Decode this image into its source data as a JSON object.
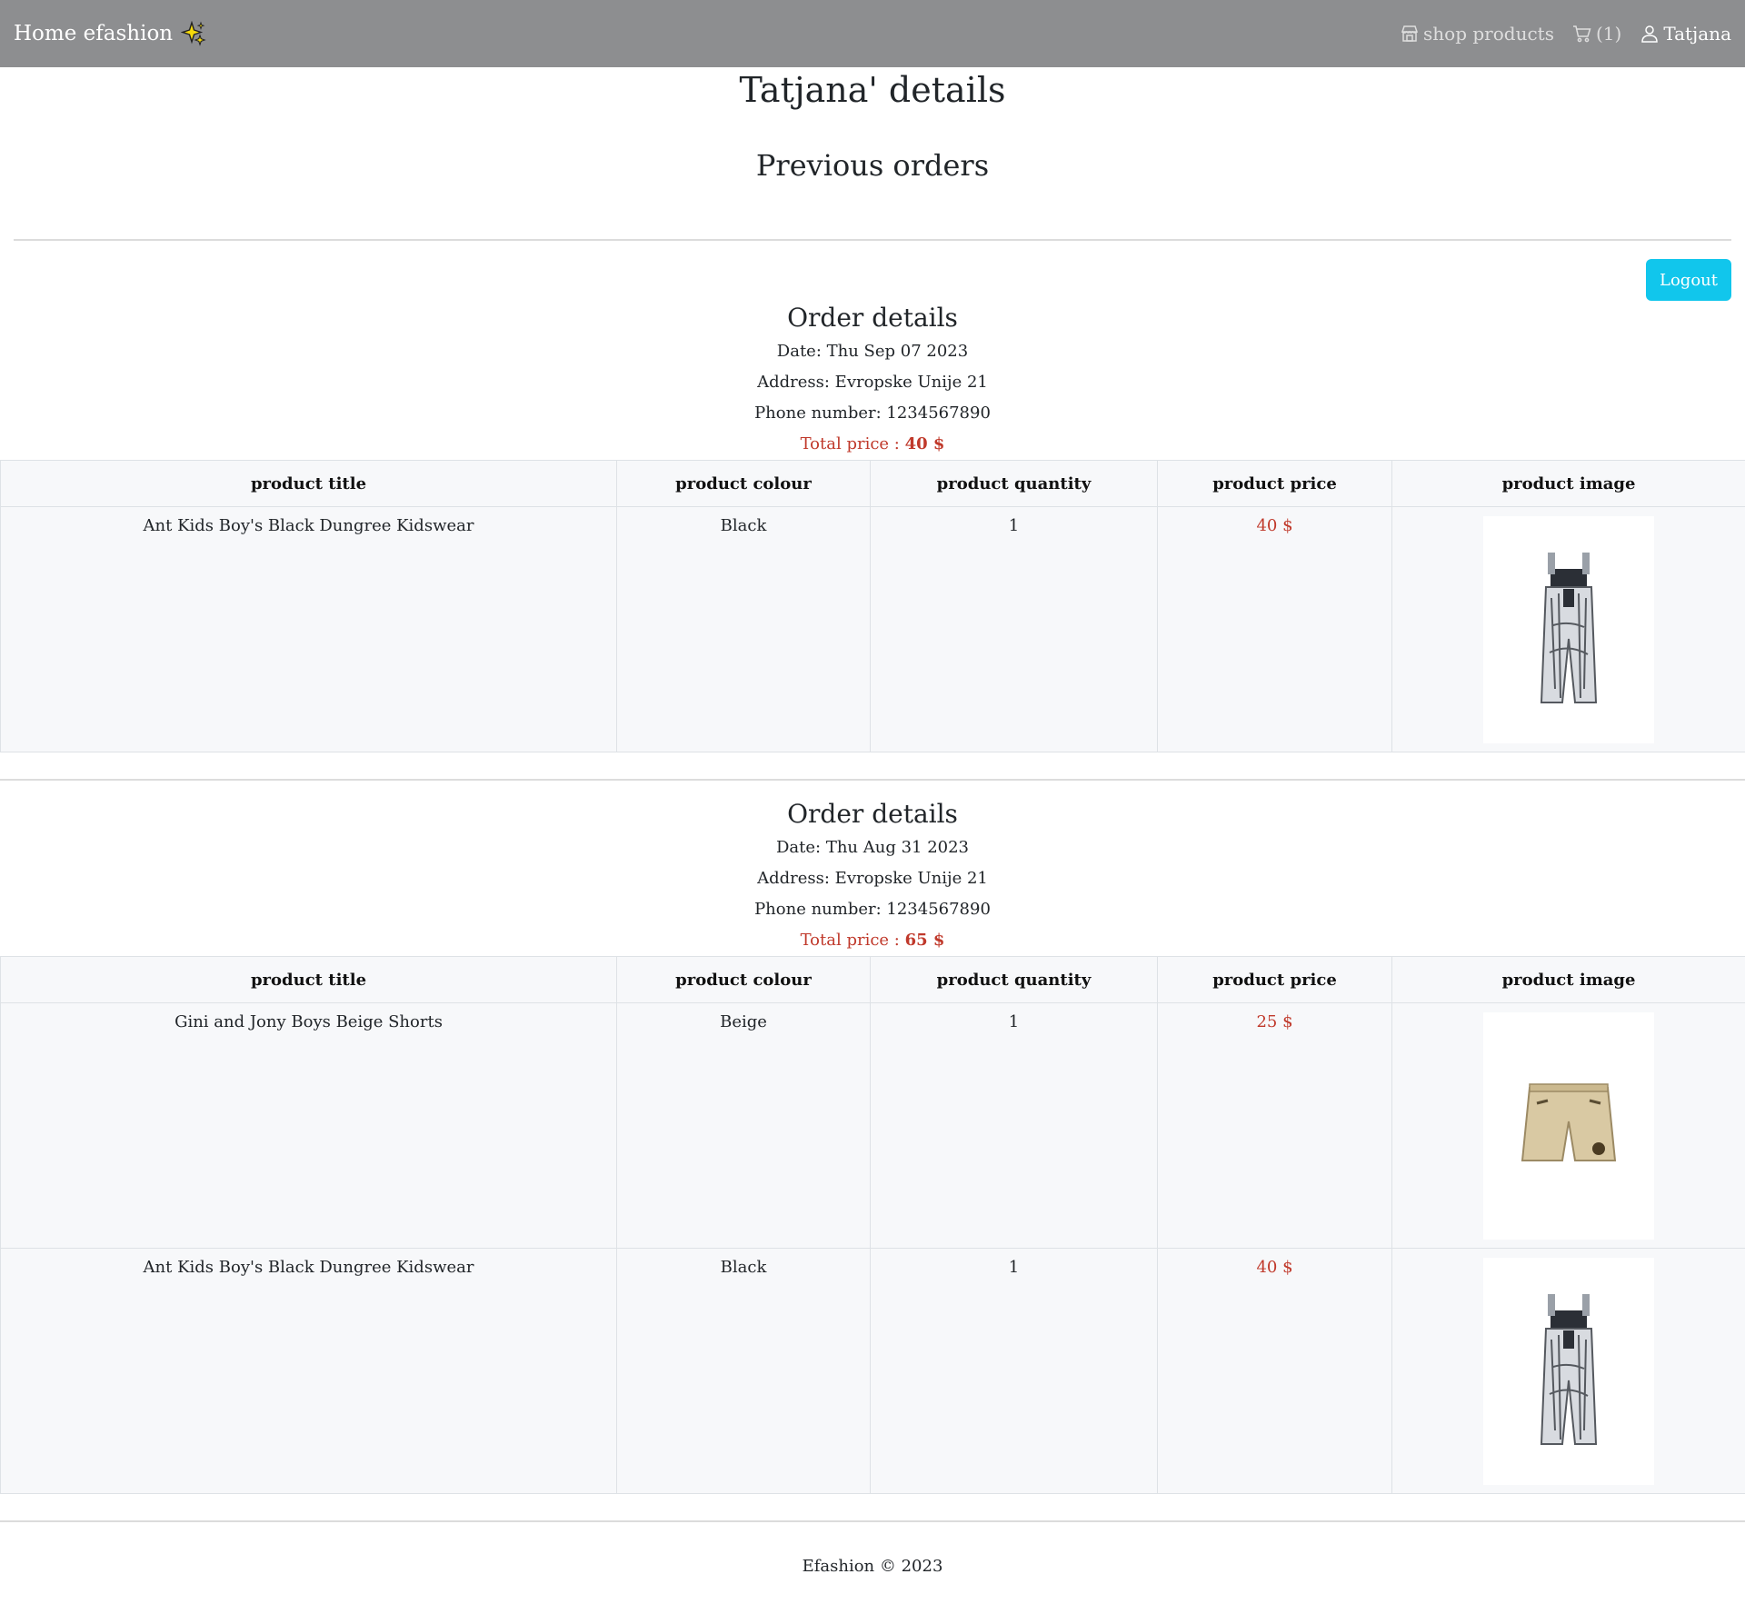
{
  "nav": {
    "brand": "Home efashion",
    "brand_icon": "sparkle-icon",
    "shop_label": "shop products",
    "cart_label": "(1)",
    "user_label": "Tatjana"
  },
  "page": {
    "title": "Tatjana' details",
    "section_title": "Previous orders",
    "logout_label": "Logout"
  },
  "table_headers": [
    "product title",
    "product colour",
    "product quantity",
    "product price",
    "product image"
  ],
  "orders": [
    {
      "title": "Order details",
      "date": "Date: Thu Sep 07 2023",
      "address": "Address: Evropske Unije 21",
      "phone": "Phone number: 1234567890",
      "total_label": "Total price :",
      "total_value": "40 $",
      "items": [
        {
          "title": "Ant Kids Boy's Black Dungree Kidswear",
          "colour": "Black",
          "quantity": "1",
          "price": "40 $",
          "image": "dungaree-image"
        }
      ]
    },
    {
      "title": "Order details",
      "date": "Date: Thu Aug 31 2023",
      "address": "Address: Evropske Unije 21",
      "phone": "Phone number: 1234567890",
      "total_label": "Total price :",
      "total_value": "65 $",
      "items": [
        {
          "title": "Gini and Jony Boys Beige Shorts",
          "colour": "Beige",
          "quantity": "1",
          "price": "25 $",
          "image": "shorts-image"
        },
        {
          "title": "Ant Kids Boy's Black Dungree Kidswear",
          "colour": "Black",
          "quantity": "1",
          "price": "40 $",
          "image": "dungaree-image"
        }
      ]
    }
  ],
  "footer": {
    "text": "Efashion © 2023"
  }
}
